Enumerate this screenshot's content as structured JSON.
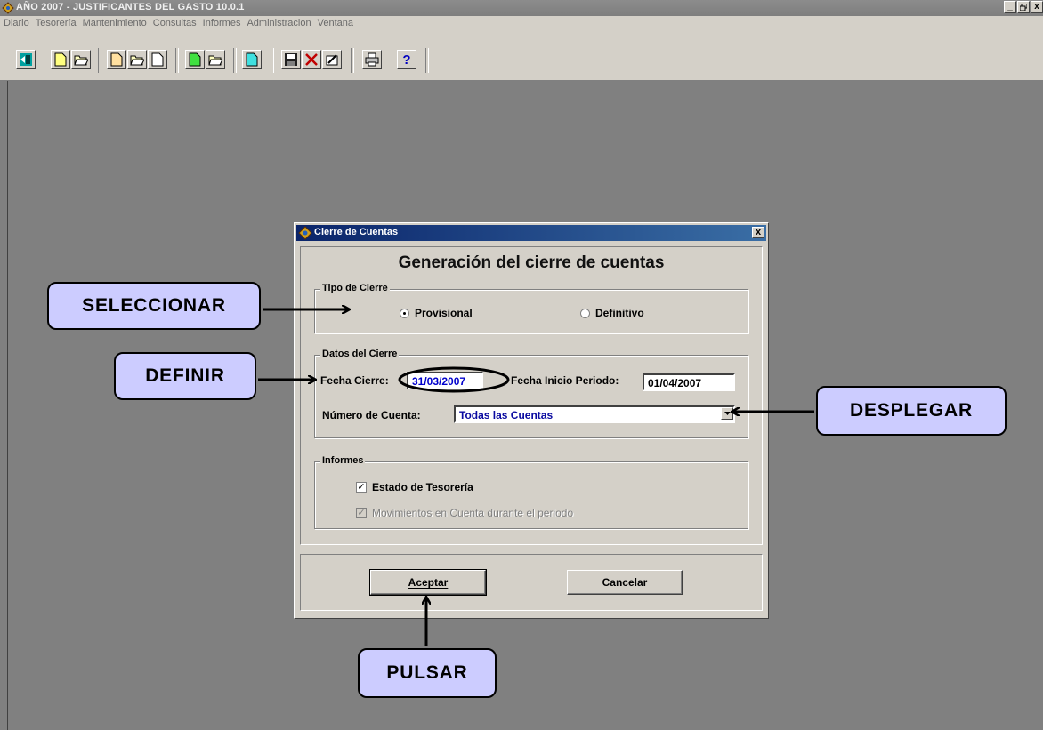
{
  "window": {
    "title": "AÑO 2007 - JUSTIFICANTES DEL GASTO 10.0.1",
    "controls": [
      "_",
      "ྫ",
      "x"
    ]
  },
  "menu": [
    "Diario",
    "Tesorería",
    "Mantenimiento",
    "Consultas",
    "Informes",
    "Administracion",
    "Ventana"
  ],
  "toolbar_icons": [
    "exit-icon",
    "new-document-icon",
    "open-folder-icon",
    "new-document-icon",
    "open-folder-icon",
    "document-icon",
    "green-document-icon",
    "open-folder-icon",
    "cyan-document-icon",
    "save-icon",
    "delete-icon",
    "edit-icon",
    "print-icon",
    "help-icon"
  ],
  "help_glyph": "?",
  "dialog": {
    "title": "Cierre de Cuentas",
    "close_glyph": "x",
    "heading": "Generación del cierre de cuentas",
    "tipo_group": "Tipo de Cierre",
    "radio_provisional": "Provisional",
    "radio_definitivo": "Definitivo",
    "selected_tipo": "Provisional",
    "datos_group": "Datos del Cierre",
    "fecha_cierre_label": "Fecha Cierre:",
    "fecha_cierre_value": "31/03/2007",
    "fecha_inicio_label": "Fecha Inicio Periodo:",
    "fecha_inicio_value": "01/04/2007",
    "cuenta_label": "Número de Cuenta:",
    "cuenta_value": "Todas las Cuentas",
    "informes_group": "Informes",
    "check_estado": "Estado de Tesorería",
    "check_estado_checked": true,
    "check_movimientos": "Movimientos en Cuenta durante el periodo",
    "check_movimientos_checked": true,
    "check_movimientos_disabled": true,
    "check_glyph": "✓",
    "accept_label": "Aceptar",
    "cancel_label": "Cancelar"
  },
  "callouts": {
    "seleccionar": "SELECCIONAR",
    "definir": "DEFINIR",
    "desplegar": "DESPLEGAR",
    "pulsar": "PULSAR"
  },
  "colors": {
    "desktop": "#808080",
    "dialog_title": "#0a246a",
    "callout_fill": "#ccccff",
    "date_value": "#0000cc"
  }
}
